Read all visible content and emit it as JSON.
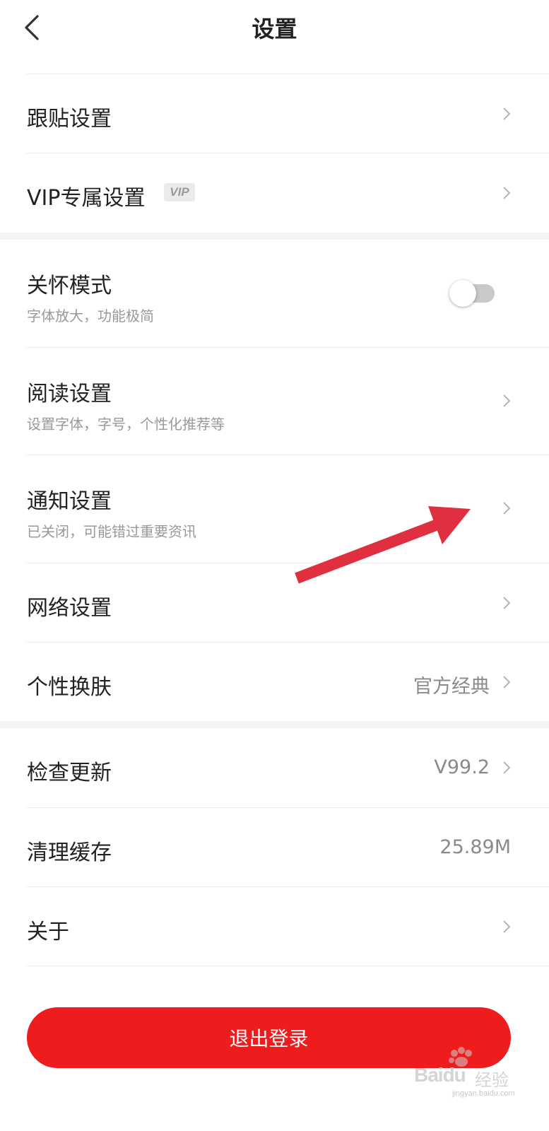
{
  "header": {
    "title": "设置",
    "back_icon": "chevron-left-icon"
  },
  "groups": {
    "group1": {
      "follow_post": {
        "label": "跟贴设置"
      },
      "vip": {
        "label": "VIP专属设置",
        "badge": "VIP"
      }
    },
    "group2": {
      "care_mode": {
        "label": "关怀模式",
        "sub": "字体放大，功能极简",
        "toggle_on": false
      },
      "reading": {
        "label": "阅读设置",
        "sub": "设置字体，字号，个性化推荐等"
      },
      "notification": {
        "label": "通知设置",
        "sub": "已关闭，可能错过重要资讯"
      },
      "network": {
        "label": "网络设置"
      },
      "skin": {
        "label": "个性换肤",
        "value": "官方经典"
      }
    },
    "group3": {
      "update": {
        "label": "检查更新",
        "value": "V99.2"
      },
      "cache": {
        "label": "清理缓存",
        "value": "25.89M"
      },
      "about": {
        "label": "关于"
      }
    }
  },
  "logout": {
    "label": "退出登录"
  },
  "annotation": {
    "color": "#e0303f",
    "icon": "red-arrow-icon"
  },
  "watermark": {
    "brand": "Baidu",
    "cn": "经验",
    "url": "jingyan.baidu.com"
  },
  "colors": {
    "accent": "#ee1c1c",
    "divider": "#ececec",
    "secondary_text": "#999999"
  }
}
